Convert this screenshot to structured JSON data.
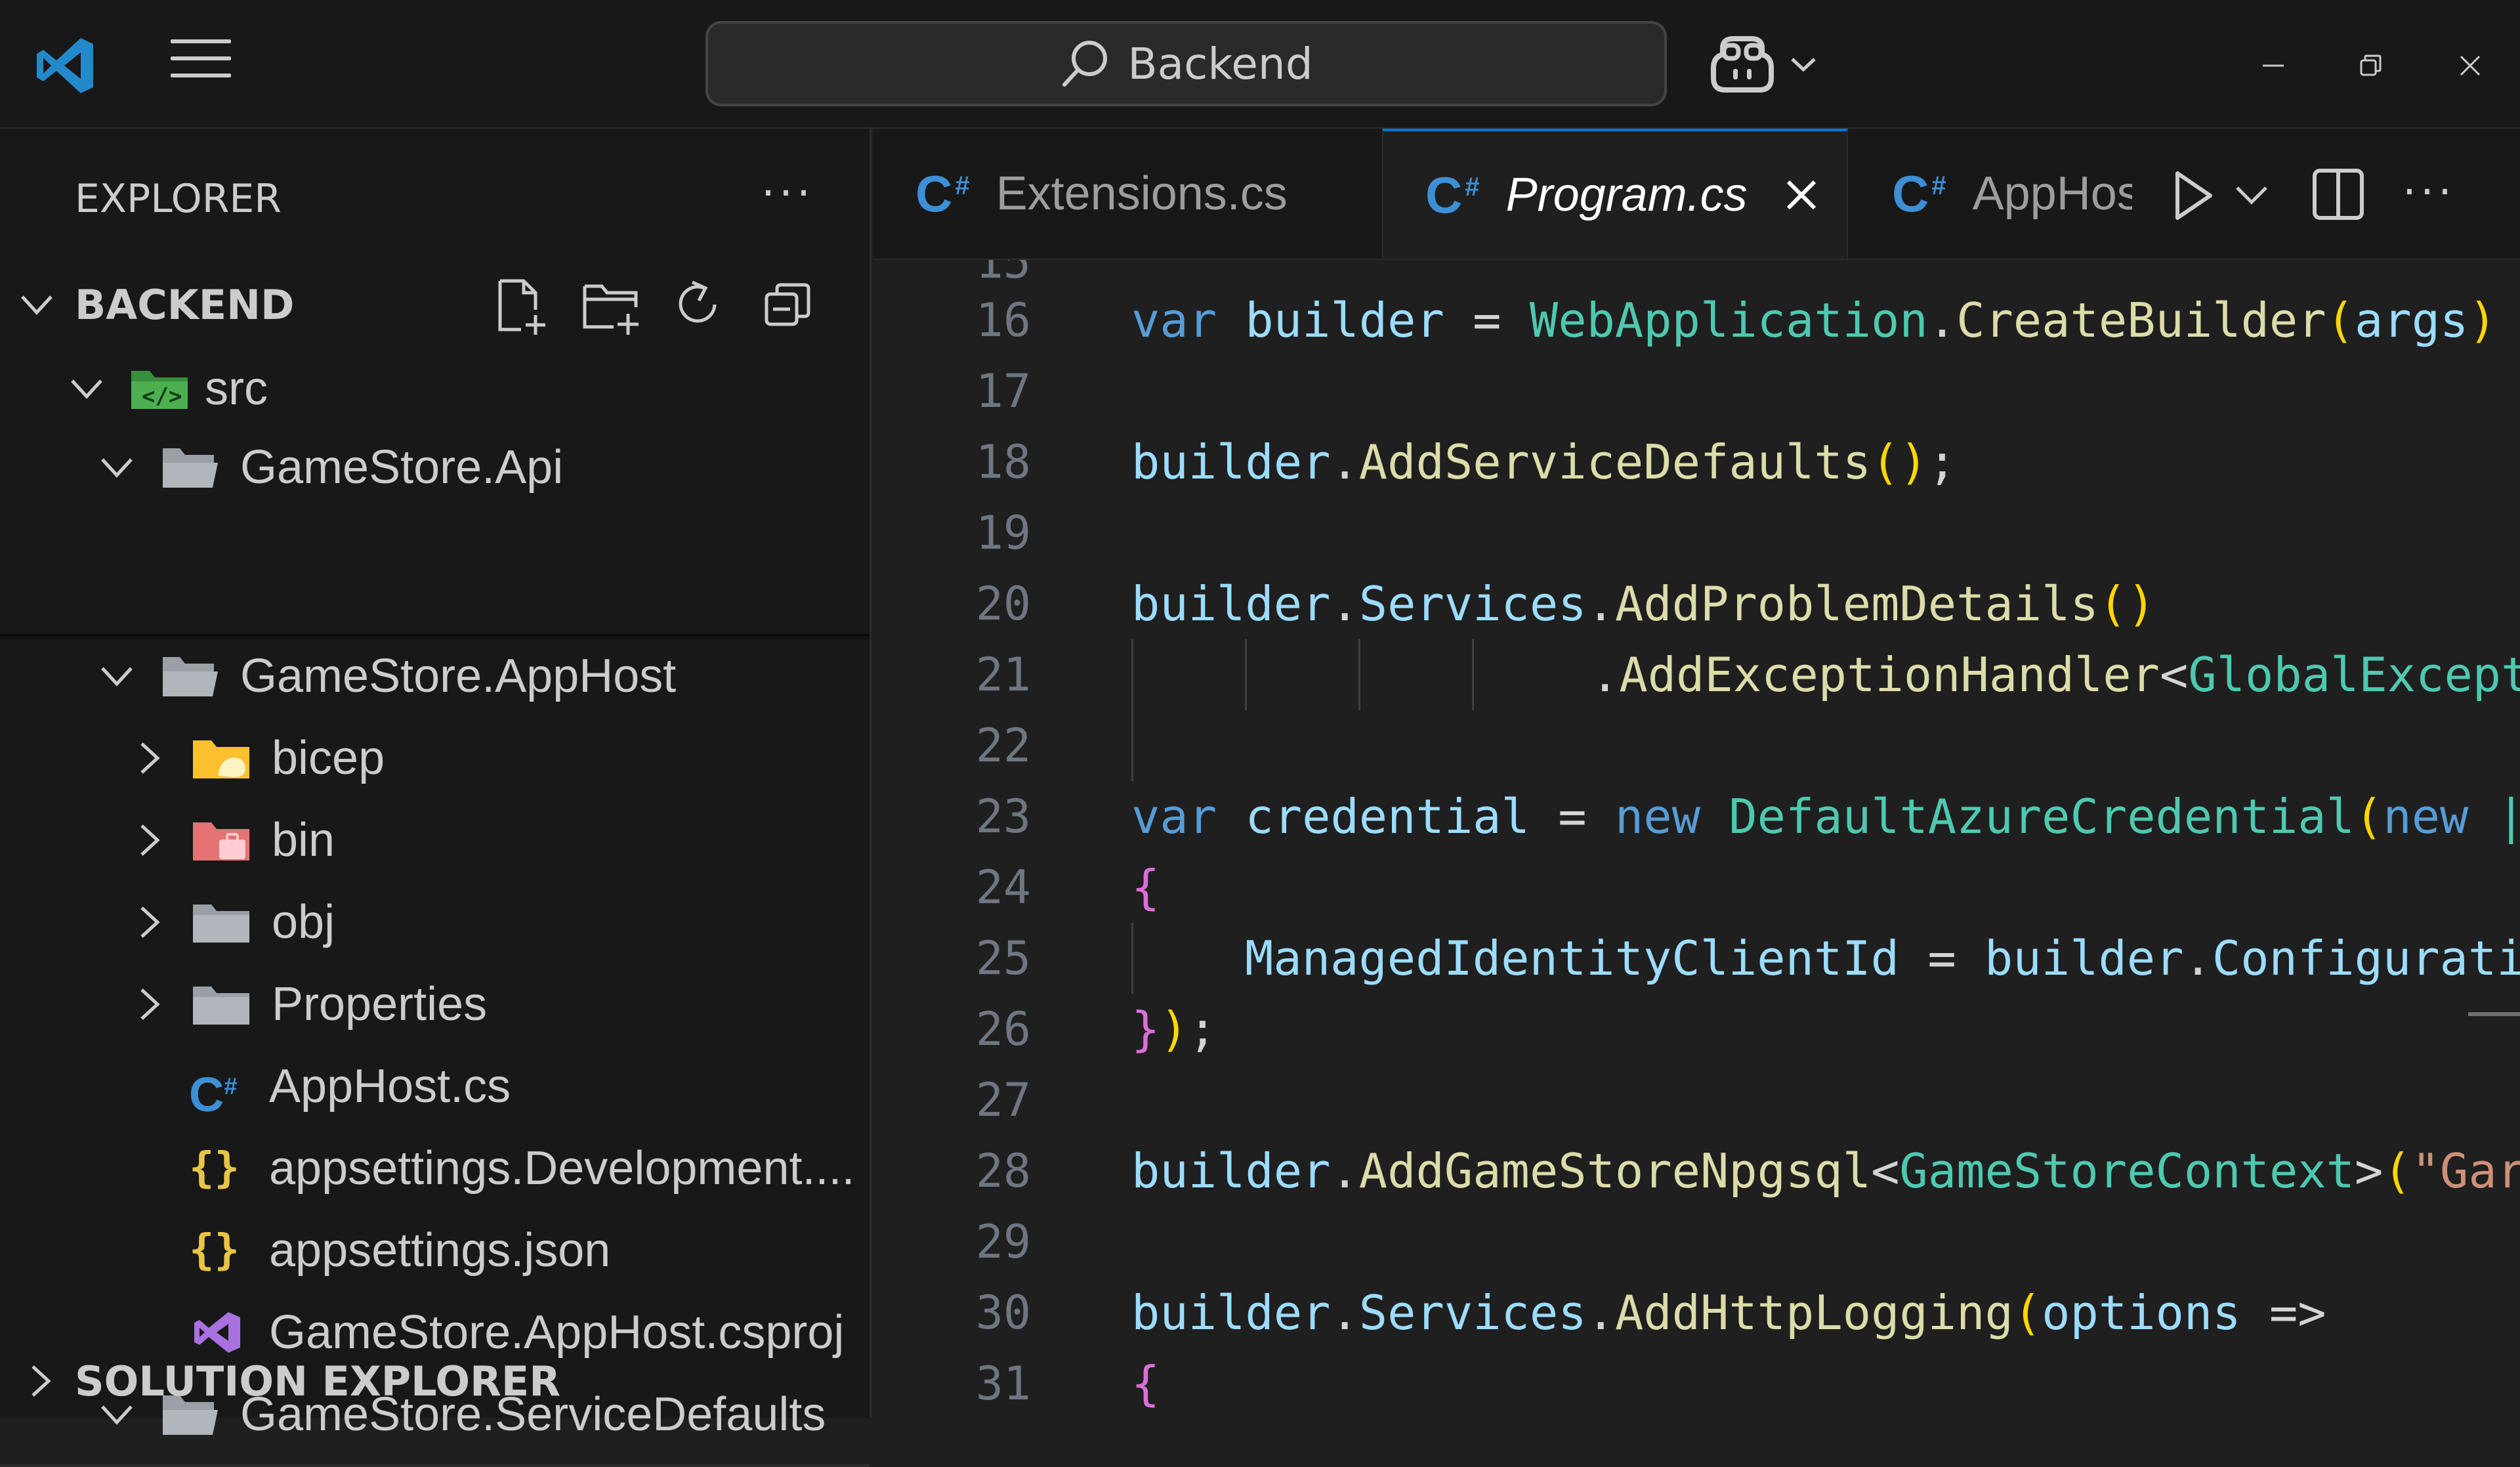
{
  "titlebar": {
    "search_text": "Backend"
  },
  "sidebar": {
    "header": "EXPLORER",
    "more": "···",
    "section_backend": "BACKEND",
    "section_solution": "SOLUTION EXPLORER",
    "tree": {
      "src": "src",
      "api": "GameStore.Api",
      "apphost": "GameStore.AppHost",
      "bicep": "bicep",
      "bin": "bin",
      "obj": "obj",
      "properties": "Properties",
      "apphost_cs": "AppHost.cs",
      "appsettings_dev": "appsettings.Development....",
      "appsettings": "appsettings.json",
      "csproj": "GameStore.AppHost.csproj",
      "servicedefaults": "GameStore.ServiceDefaults"
    }
  },
  "tabs": {
    "tab1": "Extensions.cs",
    "tab2": "Program.cs",
    "tab3": "AppHos",
    "more": "···"
  },
  "editor": {
    "line_numbers": [
      "16",
      "17",
      "18",
      "19",
      "20",
      "21",
      "22",
      "23",
      "24",
      "25",
      "26",
      "27",
      "28",
      "29",
      "30",
      "31"
    ],
    "l16": {
      "kw": "var",
      "v": " builder",
      "op": " = ",
      "t": "WebApplication",
      "dot": ".",
      "f": "CreateBuilder",
      "b": "(",
      "a": "args",
      "b2": ")"
    },
    "l18": {
      "v": "builder",
      "dot": ".",
      "f": "AddServiceDefaults",
      "b": "()",
      "semi": ";"
    },
    "l20": {
      "v": "builder",
      "dot": ".",
      "v2": "Services",
      "dot2": ".",
      "f": "AddProblemDetails",
      "b": "()"
    },
    "l21": {
      "dot": ".",
      "f": "AddExceptionHandler",
      "lt": "<",
      "t": "GlobalExcept"
    },
    "l23": {
      "kw": "var",
      "v": " credential",
      "op": " = ",
      "kw2": "new",
      "sp": " ",
      "t": "DefaultAzureCredential",
      "b": "(",
      "kw3": "new",
      "rest": " ",
      "cursor": "|"
    },
    "l24": {
      "b": "{"
    },
    "l25": {
      "v": "ManagedIdentityClientId",
      "op": " = ",
      "v2": "builder",
      "dot": ".",
      "v3": "Configurati"
    },
    "l26": {
      "b": "}",
      "b2": ")",
      "semi": ";"
    },
    "l28": {
      "v": "builder",
      "dot": ".",
      "f": "AddGameStoreNpgsql",
      "lt": "<",
      "t": "GameStoreContext",
      "gt": ">",
      "b": "(",
      "s": "\"Gar"
    },
    "l30": {
      "v": "builder",
      "dot": ".",
      "v2": "Services",
      "dot2": ".",
      "f": "AddHttpLogging",
      "b": "(",
      "a": "options",
      "op": " =>"
    },
    "l31": {
      "b": "{"
    }
  },
  "colors": {
    "accent": "#0078d4",
    "vscode_logo": "#2489ca",
    "csharp_icon": "#3d8fd6",
    "json_icon": "#e8c547",
    "csproj_icon": "#a970e0",
    "src_icon": "#4caf50",
    "bin_icon": "#e57373",
    "bicep_icon": "#fbc02d"
  }
}
